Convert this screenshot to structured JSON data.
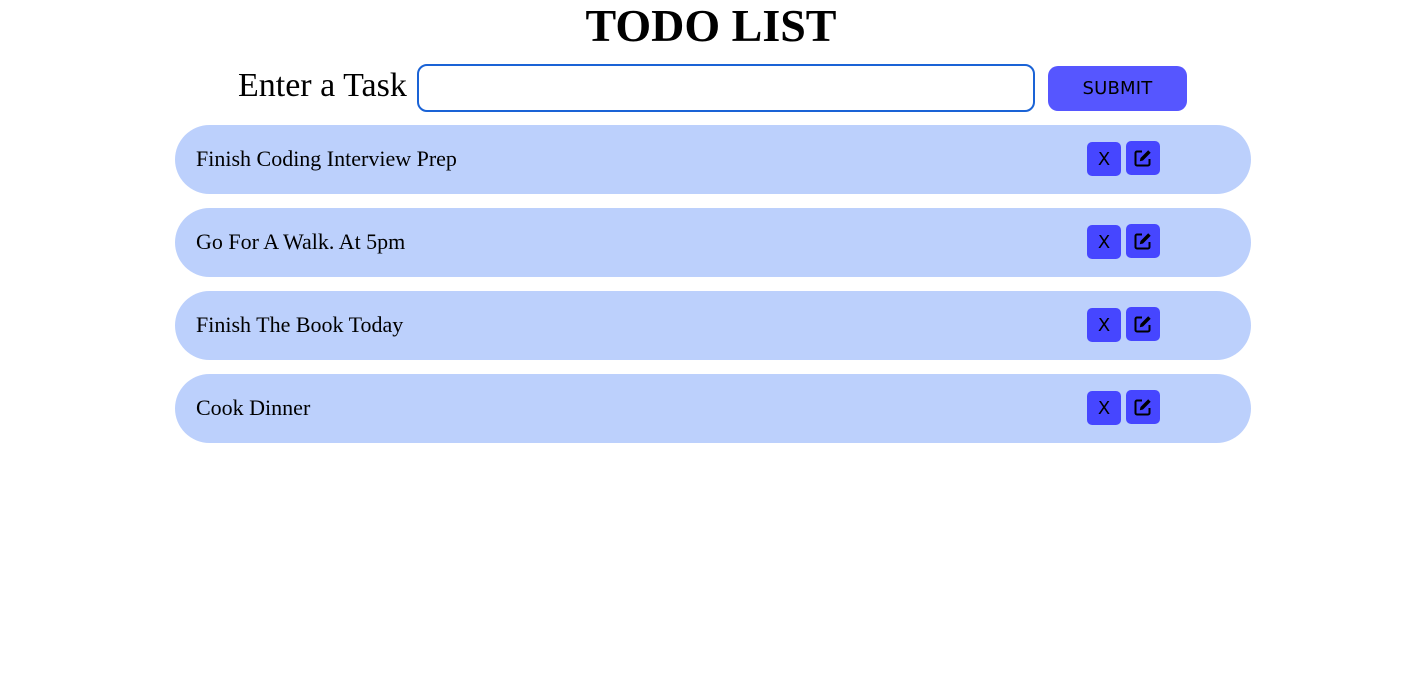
{
  "header": {
    "title": "TODO LIST"
  },
  "form": {
    "label": "Enter a Task",
    "input_value": "",
    "input_placeholder": "",
    "submit_label": "SUBMIT"
  },
  "todos": [
    {
      "text": "Finish Coding Interview Prep",
      "delete_label": "X",
      "edit_icon": "edit-icon"
    },
    {
      "text": "Go For A Walk. At 5pm",
      "delete_label": "X",
      "edit_icon": "edit-icon"
    },
    {
      "text": "Finish The Book Today",
      "delete_label": "X",
      "edit_icon": "edit-icon"
    },
    {
      "text": "Cook Dinner",
      "delete_label": "X",
      "edit_icon": "edit-icon"
    }
  ],
  "colors": {
    "item_background": "#bcd0fc",
    "button_accent": "#4646ff",
    "submit_background": "#5656ff",
    "input_border": "#1a63d6"
  }
}
